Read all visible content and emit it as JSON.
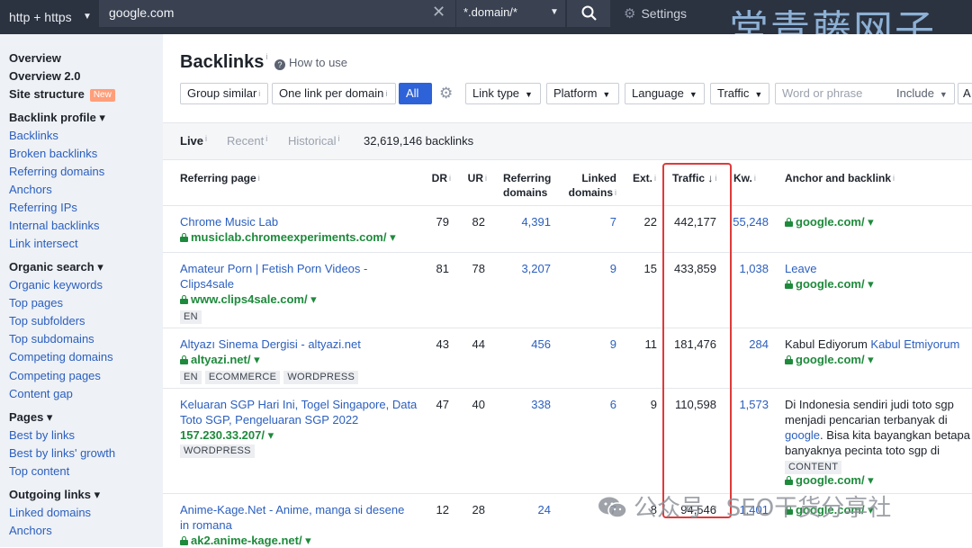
{
  "topbar": {
    "protocol": "http + https",
    "url": "google.com",
    "mode": "*.domain/*",
    "settings": "Settings",
    "watermark": "常青藤网子"
  },
  "sidebar": {
    "items": [
      {
        "label": "Overview",
        "bold": true
      },
      {
        "label": "Overview 2.0",
        "bold": true
      },
      {
        "label": "Site structure",
        "bold": true,
        "badge": "New"
      },
      {
        "label": "Backlink profile ▾",
        "bold": true
      },
      {
        "label": "Backlinks"
      },
      {
        "label": "Broken backlinks"
      },
      {
        "label": "Referring domains"
      },
      {
        "label": "Anchors"
      },
      {
        "label": "Referring IPs"
      },
      {
        "label": "Internal backlinks"
      },
      {
        "label": "Link intersect"
      },
      {
        "label": "Organic search ▾",
        "bold": true
      },
      {
        "label": "Organic keywords"
      },
      {
        "label": "Top pages"
      },
      {
        "label": "Top subfolders"
      },
      {
        "label": "Top subdomains"
      },
      {
        "label": "Competing domains"
      },
      {
        "label": "Competing pages"
      },
      {
        "label": "Content gap"
      },
      {
        "label": "Pages ▾",
        "bold": true
      },
      {
        "label": "Best by links"
      },
      {
        "label": "Best by links' growth"
      },
      {
        "label": "Top content"
      },
      {
        "label": "Outgoing links ▾",
        "bold": true
      },
      {
        "label": "Linked domains"
      },
      {
        "label": "Anchors"
      }
    ]
  },
  "main": {
    "title": "Backlinks",
    "how_to": "How to use",
    "filters": {
      "group_similar": "Group similar",
      "one_per_domain": "One link per domain",
      "all": "All",
      "link_type": "Link type",
      "platform": "Platform",
      "language": "Language",
      "traffic": "Traffic",
      "word_placeholder": "Word or phrase",
      "include": "Include",
      "more": "A"
    },
    "tabs": {
      "live": "Live",
      "recent": "Recent",
      "historical": "Historical",
      "count": "32,619,146 backlinks"
    },
    "columns": {
      "referring_page": "Referring page",
      "dr": "DR",
      "ur": "UR",
      "ref_domains_1": "Referring",
      "ref_domains_2": "domains",
      "linked_domains_1": "Linked",
      "linked_domains_2": "domains",
      "ext": "Ext.",
      "traffic": "Traffic ↓",
      "kw": "Kw.",
      "anchor": "Anchor and backlink"
    },
    "rows": [
      {
        "title": "Chrome Music Lab",
        "url": "musiclab.chromeexperiments.com/ ▾",
        "dr": "79",
        "ur": "82",
        "ref_domains": "4,391",
        "linked_domains": "7",
        "ext": "22",
        "traffic": "442,177",
        "kw": "55,248",
        "backlink": "google.com/ ▾"
      },
      {
        "title_1": "Amateur Porn | Fetish Porn Videos -",
        "title_2": "Clips4sale",
        "url": "www.clips4sale.com/ ▾",
        "tag": "EN",
        "dr": "81",
        "ur": "78",
        "ref_domains": "3,207",
        "linked_domains": "9",
        "ext": "15",
        "traffic": "433,859",
        "kw": "1,038",
        "anchor": "Leave",
        "backlink": "google.com/ ▾"
      },
      {
        "title": "Altyazı Sinema Dergisi - altyazi.net",
        "url": "altyazi.net/ ▾",
        "tags": [
          "EN",
          "ECOMMERCE",
          "WORDPRESS"
        ],
        "dr": "43",
        "ur": "44",
        "ref_domains": "456",
        "linked_domains": "9",
        "ext": "11",
        "traffic": "181,476",
        "kw": "284",
        "anchor_text": "Kabul Ediyorum",
        "anchor_link": "Kabul Etmiyorum",
        "backlink": "google.com/ ▾"
      },
      {
        "title_1": "Keluaran SGP Hari Ini, Togel Singapore, Data",
        "title_2": "Toto SGP, Pengeluaran SGP 2022",
        "url": "157.230.33.207/ ▾",
        "tag": "WORDPRESS",
        "dr": "47",
        "ur": "40",
        "ref_domains": "338",
        "linked_domains": "6",
        "ext": "9",
        "traffic": "110,598",
        "kw": "1,573",
        "anchor_1": "Di Indonesia sendiri judi toto sgp",
        "anchor_2": "menjadi pencarian terbanyak di",
        "anchor_link": "google",
        "anchor_3": ". Bisa kita bayangkan betapa",
        "anchor_4": "banyaknya pecinta toto sgp di",
        "tag2": "CONTENT",
        "backlink": "google.com/ ▾"
      },
      {
        "title_1": "Anime-Kage.Net - Anime, manga si desene",
        "title_2": "in romana",
        "url": "ak2.anime-kage.net/ ▾",
        "dr": "12",
        "ur": "28",
        "ref_domains": "24",
        "linked_domains": "7",
        "ext": "8",
        "traffic": "94,546",
        "kw": "1,401",
        "backlink": "google.com/ ▾"
      }
    ],
    "watermark": "公众号 · SEO干货分享社"
  },
  "colors": {
    "topbar": "#2b3240",
    "sidebar": "#eef1f5",
    "link": "#2b5fbf",
    "url_green": "#1e8a3c",
    "accent": "#2e62d9",
    "highlight": "#e03a3a"
  }
}
